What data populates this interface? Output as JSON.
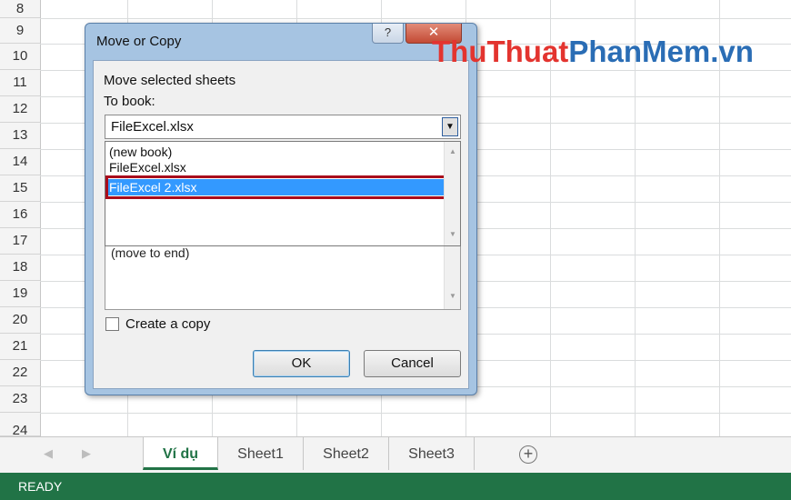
{
  "rows": [
    "8",
    "9",
    "10",
    "11",
    "12",
    "13",
    "14",
    "15",
    "16",
    "17",
    "18",
    "19",
    "20",
    "21",
    "22",
    "23",
    "24"
  ],
  "sheet_tabs": [
    "Ví dụ",
    "Sheet1",
    "Sheet2",
    "Sheet3"
  ],
  "active_tab": "Ví dụ",
  "status_text": "READY",
  "dialog": {
    "title": "Move or Copy",
    "help_glyph": "?",
    "close_glyph": "✕",
    "move_label": "Move selected sheets",
    "to_book_label": "To book:",
    "to_book_value": "FileExcel.xlsx",
    "before_sheet_hidden_item": "(move to end)",
    "dropdown_options": [
      "(new book)",
      "FileExcel.xlsx",
      "FileExcel 2.xlsx"
    ],
    "selected_option": "FileExcel 2.xlsx",
    "create_copy_label": "Create a copy",
    "create_copy_checked": false,
    "ok_label": "OK",
    "cancel_label": "Cancel"
  },
  "watermark": {
    "part1": "Thu",
    "part2": "Thuat",
    "part3": "PhanMem",
    "part4": ".vn"
  },
  "colors": {
    "excel_green": "#217346",
    "selection": "#3399ff",
    "highlight_box": "#a90d1c"
  }
}
